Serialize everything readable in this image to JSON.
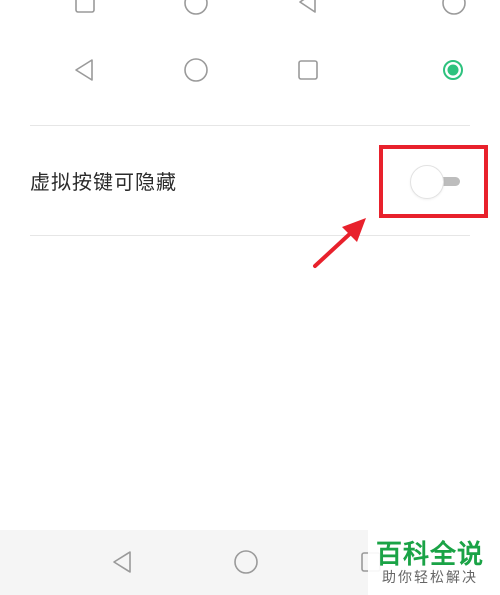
{
  "setting": {
    "label": "虚拟按键可隐藏",
    "toggle_on": false
  },
  "icons": {
    "top_partial_row": [
      "square-icon",
      "circle-icon",
      "triangle-back-icon",
      "circle-icon"
    ],
    "layout_option_row": [
      "triangle-back-icon",
      "circle-icon",
      "square-icon",
      "radio-selected-icon"
    ],
    "navbar": [
      "back-icon",
      "home-icon",
      "recents-icon"
    ]
  },
  "colors": {
    "accent": "#2ec27e",
    "highlight": "#e8212c",
    "watermark_green": "#1aa346"
  },
  "watermark": {
    "title": "百科全说",
    "subtitle": "助你轻松解决"
  }
}
